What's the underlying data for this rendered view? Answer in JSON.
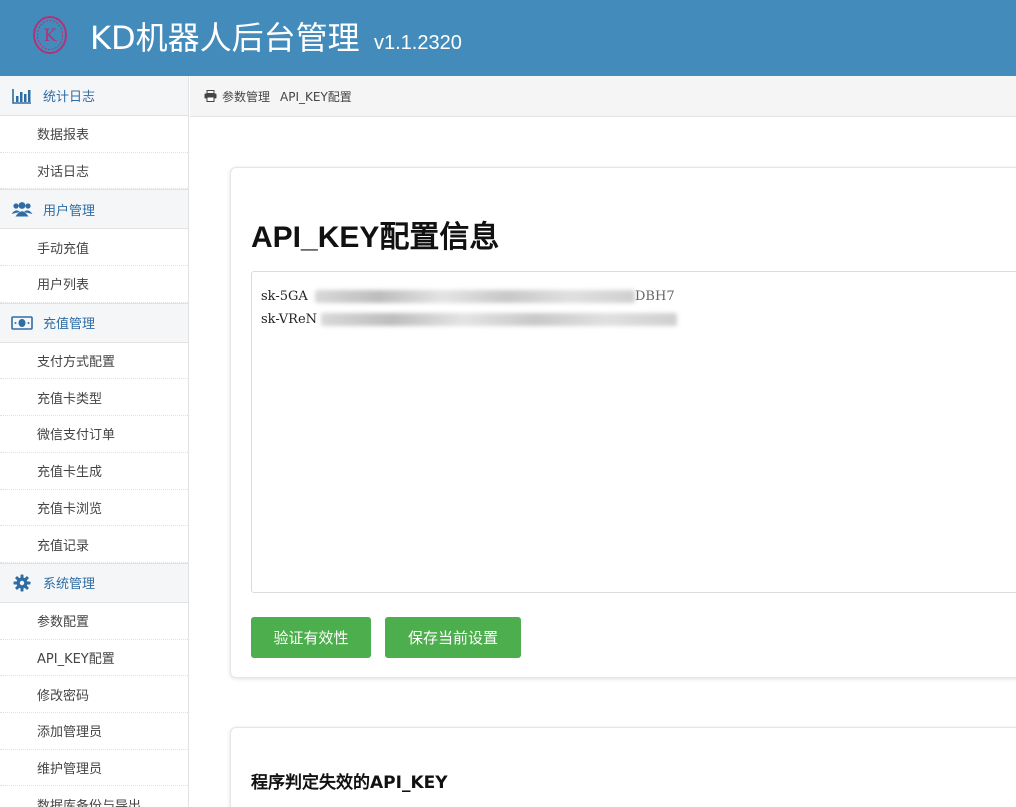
{
  "header": {
    "title": "KD机器人后台管理",
    "version": "v1.1.2320",
    "logo_letter": "K",
    "bg_color": "#428bba"
  },
  "sidebar": {
    "groups": [
      {
        "label": "统计日志",
        "icon": "bar-chart-icon",
        "items": [
          "数据报表",
          "对话日志"
        ]
      },
      {
        "label": "用户管理",
        "icon": "users-icon",
        "items": [
          "手动充值",
          "用户列表"
        ]
      },
      {
        "label": "充值管理",
        "icon": "money-icon",
        "items": [
          "支付方式配置",
          "充值卡类型",
          "微信支付订单",
          "充值卡生成",
          "充值卡浏览",
          "充值记录"
        ]
      },
      {
        "label": "系统管理",
        "icon": "gear-icon",
        "items": [
          "参数配置",
          "API_KEY配置",
          "修改密码",
          "添加管理员",
          "维护管理员",
          "数据库备份与导出"
        ]
      }
    ]
  },
  "breadcrumb": {
    "icon": "print-icon",
    "items": [
      "参数管理",
      "API_KEY配置"
    ]
  },
  "main": {
    "card_title": "API_KEY配置信息",
    "keys": [
      {
        "visible": "sk-5GA",
        "tail": "DBH7"
      },
      {
        "visible": "sk-VReN",
        "tail": ""
      }
    ],
    "buttons": {
      "verify": "验证有效性",
      "save": "保存当前设置"
    },
    "button_color": "#4cae4c",
    "invalid_title": "程序判定失效的API_KEY"
  }
}
